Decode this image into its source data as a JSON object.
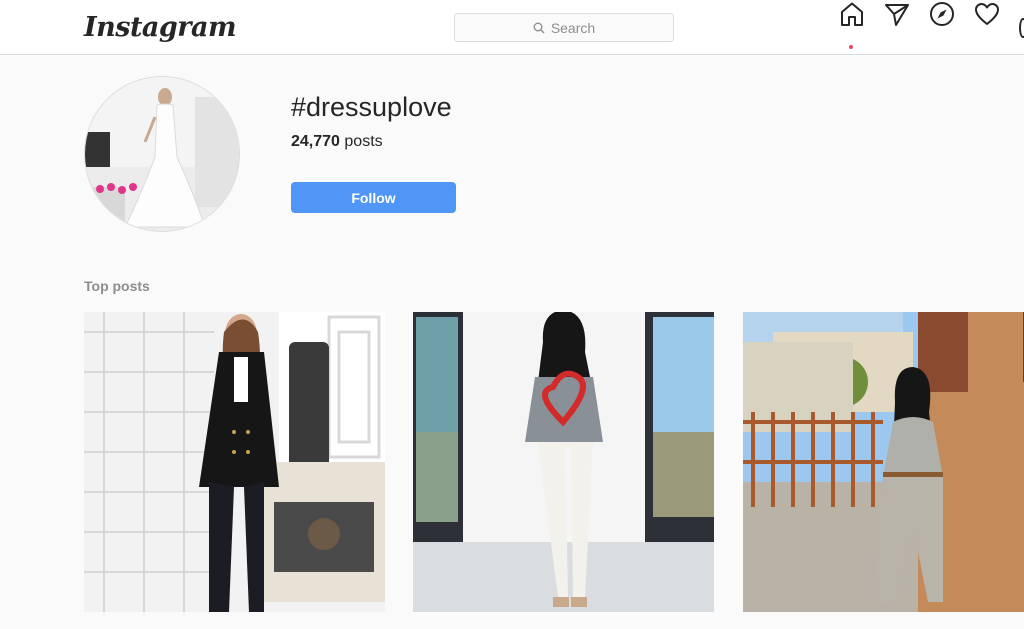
{
  "nav": {
    "logo": "Instagram",
    "search_placeholder": "Search",
    "icons": [
      "home-icon",
      "direct-icon",
      "explore-icon",
      "activity-heart-icon",
      "profile-icon"
    ]
  },
  "hashtag": {
    "title": "#dressuplove",
    "post_count": "24,770",
    "posts_label": "posts",
    "follow_label": "Follow"
  },
  "sections": {
    "top_posts_label": "Top posts"
  },
  "top_posts": [
    {
      "alt": "woman in black blazer"
    },
    {
      "alt": "woman in gray sweater with red heart"
    },
    {
      "alt": "woman in gray knit dress"
    }
  ],
  "colors": {
    "accent": "#4f96f6",
    "notification": "#ed4956",
    "muted": "#8e8e8e"
  }
}
